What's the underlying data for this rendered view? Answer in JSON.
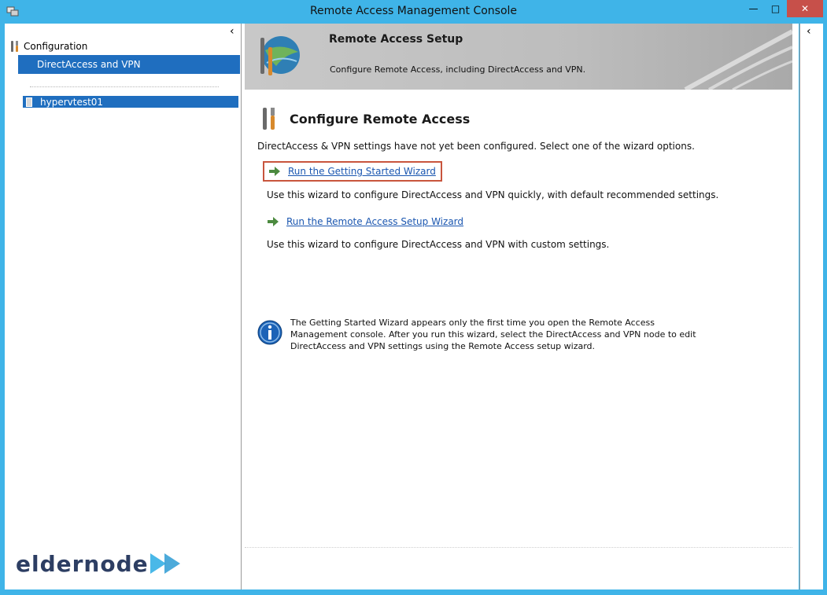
{
  "window": {
    "title": "Remote Access Management Console",
    "controls": {
      "minimize": "—",
      "maximize": "□",
      "close": "✕"
    },
    "accent_color": "#3fb4e8",
    "close_color": "#c7504a"
  },
  "tree": {
    "collapse_icon": "‹",
    "root_label": "Configuration",
    "root_icon": "tools-icon",
    "selected_item": "DirectAccess and VPN",
    "server_label": "hypervtest01",
    "server_icon": "server-icon",
    "selection_color": "#1f6ebf"
  },
  "banner": {
    "title": "Remote Access Setup",
    "description": "Configure Remote Access, including DirectAccess and VPN.",
    "icon": "globe-tools-icon"
  },
  "main": {
    "section_title": "Configure Remote Access",
    "section_icon": "tools-icon",
    "status": "DirectAccess & VPN settings have not yet been configured. Select one of the wizard options.",
    "wizards": [
      {
        "label": "Run the Getting Started Wizard",
        "description": "Use this wizard to configure DirectAccess and VPN quickly, with default recommended settings.",
        "icon": "green-arrow-icon",
        "highlighted": true,
        "highlight_color": "#c8553d"
      },
      {
        "label": "Run the Remote Access Setup Wizard",
        "description": "Use this wizard to configure DirectAccess and VPN with custom settings.",
        "icon": "green-arrow-icon"
      }
    ],
    "info_icon": "info-icon",
    "info": "The Getting Started Wizard appears only the first time you open the Remote Access Management console. After you run this wizard, select the DirectAccess and VPN node to edit DirectAccess and VPN settings using the Remote Access setup wizard."
  },
  "actions_pane": {
    "collapse_icon": "‹"
  },
  "watermark": {
    "text": "eldernode",
    "color": "#2d3e63"
  }
}
